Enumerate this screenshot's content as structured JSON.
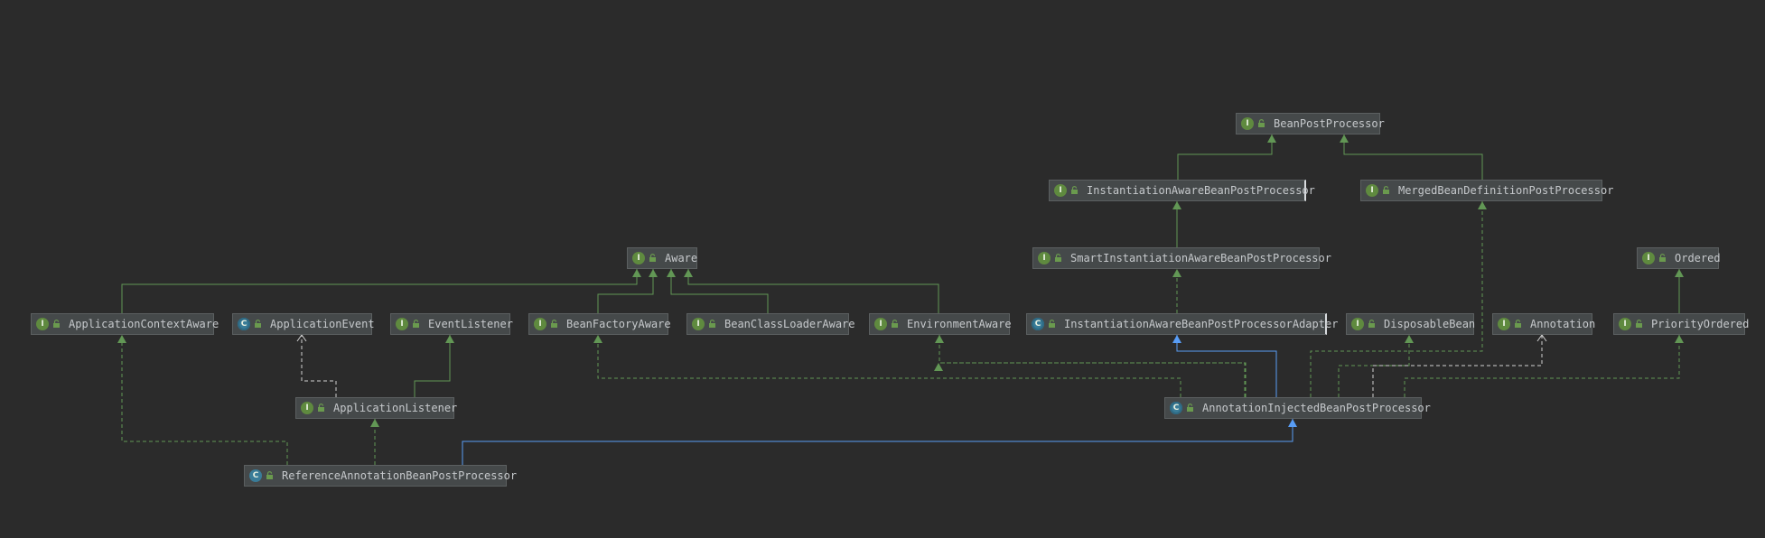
{
  "colors": {
    "background": "#2b2b2b",
    "node_fill": "#45494a",
    "node_border": "#5b5f60",
    "text": "#c6c9cc",
    "interface_edge": "#629755",
    "implements_edge": "#629755",
    "extends_edge": "#589df6",
    "white_edge": "#d0d0d0"
  },
  "nodes": [
    {
      "id": "bpp",
      "label": "BeanPostProcessor",
      "kind": "interface",
      "kind_glyph": "I",
      "icon": "interface-icon"
    },
    {
      "id": "iabpp",
      "label": "InstantiationAwareBeanPostProcessor",
      "kind": "interface",
      "kind_glyph": "I",
      "icon": "interface-icon"
    },
    {
      "id": "mbdpp",
      "label": "MergedBeanDefinitionPostProcessor",
      "kind": "interface",
      "kind_glyph": "I",
      "icon": "interface-icon"
    },
    {
      "id": "siabpp",
      "label": "SmartInstantiationAwareBeanPostProcessor",
      "kind": "interface",
      "kind_glyph": "I",
      "icon": "interface-icon"
    },
    {
      "id": "aware",
      "label": "Aware",
      "kind": "interface",
      "kind_glyph": "I",
      "icon": "interface-icon"
    },
    {
      "id": "ordered",
      "label": "Ordered",
      "kind": "interface",
      "kind_glyph": "I",
      "icon": "interface-icon"
    },
    {
      "id": "aca",
      "label": "ApplicationContextAware",
      "kind": "interface",
      "kind_glyph": "I",
      "icon": "interface-icon"
    },
    {
      "id": "ae",
      "label": "ApplicationEvent",
      "kind": "abstract-class",
      "kind_glyph": "C",
      "icon": "abstract-class-icon"
    },
    {
      "id": "el",
      "label": "EventListener",
      "kind": "interface",
      "kind_glyph": "I",
      "icon": "interface-icon"
    },
    {
      "id": "bfa",
      "label": "BeanFactoryAware",
      "kind": "interface",
      "kind_glyph": "I",
      "icon": "interface-icon"
    },
    {
      "id": "bcla",
      "label": "BeanClassLoaderAware",
      "kind": "interface",
      "kind_glyph": "I",
      "icon": "interface-icon"
    },
    {
      "id": "ea",
      "label": "EnvironmentAware",
      "kind": "interface",
      "kind_glyph": "I",
      "icon": "interface-icon"
    },
    {
      "id": "iabppa",
      "label": "InstantiationAwareBeanPostProcessorAdapter",
      "kind": "abstract-class",
      "kind_glyph": "C",
      "icon": "abstract-class-icon"
    },
    {
      "id": "db",
      "label": "DisposableBean",
      "kind": "interface",
      "kind_glyph": "I",
      "icon": "interface-icon"
    },
    {
      "id": "ann",
      "label": "Annotation",
      "kind": "interface",
      "kind_glyph": "I",
      "icon": "interface-icon"
    },
    {
      "id": "po",
      "label": "PriorityOrdered",
      "kind": "interface",
      "kind_glyph": "I",
      "icon": "interface-icon"
    },
    {
      "id": "al",
      "label": "ApplicationListener",
      "kind": "interface",
      "kind_glyph": "I",
      "icon": "interface-icon"
    },
    {
      "id": "aibpp",
      "label": "AnnotationInjectedBeanPostProcessor",
      "kind": "abstract-class",
      "kind_glyph": "C",
      "icon": "abstract-class-icon"
    },
    {
      "id": "rabpp",
      "label": "ReferenceAnnotationBeanPostProcessor",
      "kind": "class",
      "kind_glyph": "C",
      "icon": "class-icon"
    }
  ],
  "edges": [
    {
      "from": "iabpp",
      "to": "bpp",
      "type": "extends-interface"
    },
    {
      "from": "mbdpp",
      "to": "bpp",
      "type": "extends-interface"
    },
    {
      "from": "siabpp",
      "to": "iabpp",
      "type": "extends-interface"
    },
    {
      "from": "iabppa",
      "to": "siabpp",
      "type": "implements"
    },
    {
      "from": "po",
      "to": "ordered",
      "type": "extends-interface"
    },
    {
      "from": "aca",
      "to": "aware",
      "type": "extends-interface"
    },
    {
      "from": "bfa",
      "to": "aware",
      "type": "extends-interface"
    },
    {
      "from": "bcla",
      "to": "aware",
      "type": "extends-interface"
    },
    {
      "from": "ea",
      "to": "aware",
      "type": "extends-interface"
    },
    {
      "from": "al",
      "to": "el",
      "type": "extends-interface"
    },
    {
      "from": "al",
      "to": "ae",
      "type": "generic-dependency"
    },
    {
      "from": "aibpp",
      "to": "iabppa",
      "type": "extends-class"
    },
    {
      "from": "aibpp",
      "to": "bfa",
      "type": "implements"
    },
    {
      "from": "aibpp",
      "to": "bcla",
      "type": "implements"
    },
    {
      "from": "aibpp",
      "to": "ea",
      "type": "implements"
    },
    {
      "from": "aibpp",
      "to": "mbdpp",
      "type": "implements"
    },
    {
      "from": "aibpp",
      "to": "db",
      "type": "implements"
    },
    {
      "from": "aibpp",
      "to": "ann",
      "type": "generic-dependency"
    },
    {
      "from": "aibpp",
      "to": "po",
      "type": "implements"
    },
    {
      "from": "rabpp",
      "to": "aibpp",
      "type": "extends-class"
    },
    {
      "from": "rabpp",
      "to": "al",
      "type": "implements"
    },
    {
      "from": "rabpp",
      "to": "aca",
      "type": "implements"
    }
  ]
}
